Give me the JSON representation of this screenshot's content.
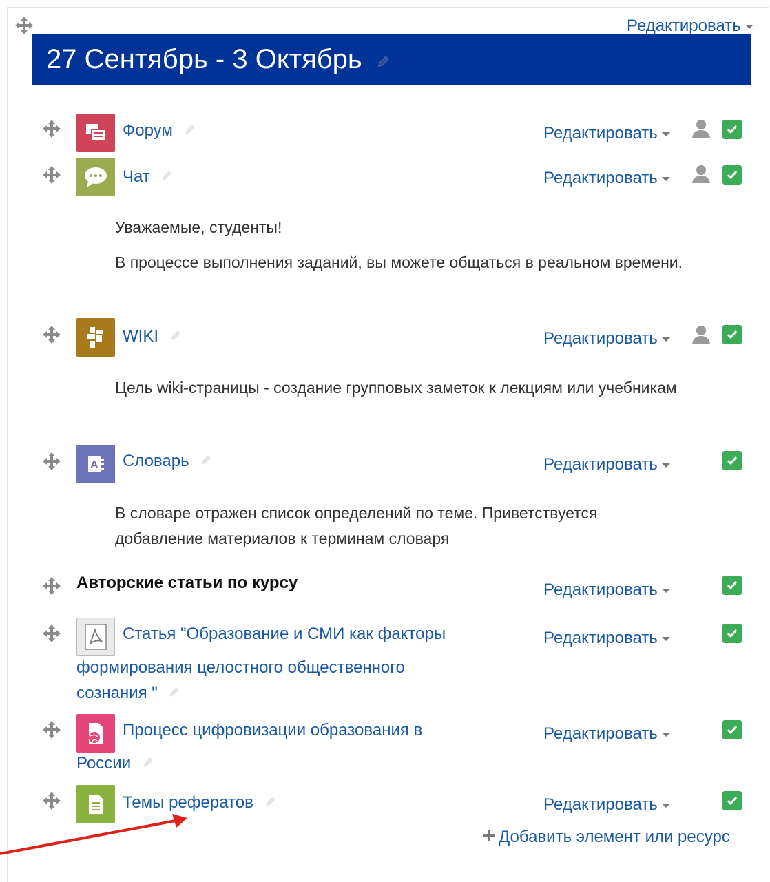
{
  "section": {
    "title": "27 Сентябрь - 3 Октябрь",
    "edit_label": "Редактировать"
  },
  "activities": [
    {
      "name": "Форум",
      "edit_label": "Редактировать",
      "icon": "forum-icon",
      "has_user_icon": true
    },
    {
      "name": "Чат",
      "edit_label": "Редактировать",
      "icon": "chat-icon",
      "has_user_icon": true,
      "description": [
        "Уважаемые, студенты!",
        "В процессе выполнения заданий, вы можете общаться в реальном времени."
      ]
    },
    {
      "name": "WIKI",
      "edit_label": "Редактировать",
      "icon": "wiki-icon",
      "has_user_icon": true,
      "description": [
        "Цель wiki-страницы - создание групповых заметок к лекциям или учебникам"
      ]
    },
    {
      "name": "Словарь",
      "edit_label": "Редактировать",
      "icon": "glossary-icon",
      "has_user_icon": false,
      "description": [
        "В словаре отражен список определений по теме. Приветствуется добавление материалов к терминам словаря"
      ]
    },
    {
      "name": "Авторские статьи по курсу",
      "edit_label": "Редактировать",
      "type": "label"
    },
    {
      "name_line1": "Статья \"Образование и СМИ как факторы",
      "name_line2": "формирования целостного общественного",
      "name_line3": "сознания \"",
      "edit_label": "Редактировать",
      "icon": "pdf-icon"
    },
    {
      "name_line1": "Процесс цифровизации образования в",
      "name_line2": "России",
      "edit_label": "Редактировать",
      "icon": "web-page-icon"
    },
    {
      "name": "Темы рефератов",
      "edit_label": "Редактировать",
      "icon": "page-icon"
    }
  ],
  "add_resource_label": "Добавить элемент или ресурс",
  "colors": {
    "banner": "#003398",
    "link": "#1a5aa3",
    "check": "#3dac56",
    "annotation_arrow": "#e0201b"
  }
}
